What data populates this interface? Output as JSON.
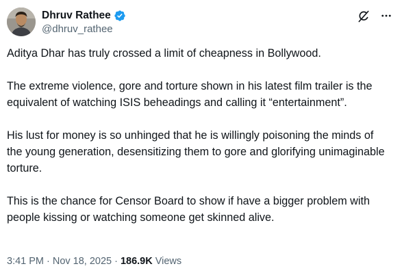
{
  "author": {
    "display_name": "Dhruv Rathee",
    "handle": "@dhruv_rathee",
    "verified_icon": "verified-badge-icon",
    "verified_color": "#1d9bf0"
  },
  "tweet": {
    "paragraphs": [
      "Aditya Dhar has truly crossed a limit of cheapness in Bollywood.",
      "The extreme violence, gore and torture  shown in his latest film trailer is the equivalent of watching ISIS beheadings and calling it “entertainment”.",
      "His lust for money is so unhinged that he is willingly poisoning the minds of the young generation, desensitizing them to gore and glorifying unimaginable torture.",
      "This is the chance for Censor Board to show if have a bigger problem with people kissing or watching someone get skinned alive."
    ]
  },
  "meta": {
    "time": "3:41 PM",
    "date": "Nov 18, 2025",
    "separator": "·",
    "views_count": "186.9K",
    "views_label": "Views"
  },
  "actions": {
    "grok_icon": "grok-icon",
    "more_icon": "more-icon"
  },
  "colors": {
    "text": "#0f1419",
    "secondary": "#536471",
    "accent": "#1d9bf0"
  }
}
